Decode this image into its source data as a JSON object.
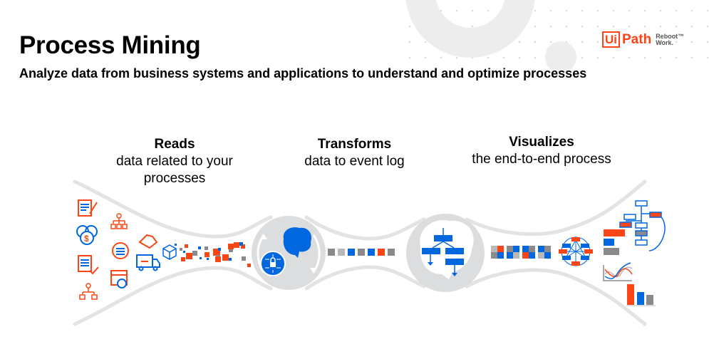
{
  "header": {
    "title": "Process Mining",
    "subtitle": "Analyze data from business systems and applications to understand and optimize processes"
  },
  "logo": {
    "brand_box": "Ui",
    "brand_text": "Path",
    "tagline_line1": "Reboot™",
    "tagline_line2": "Work."
  },
  "stages": [
    {
      "heading": "Reads",
      "line1": "data related to your",
      "line2": "processes"
    },
    {
      "heading": "Transforms",
      "line1": "data to event log",
      "line2": ""
    },
    {
      "heading": "Visualizes",
      "line1": "the end-to-end process",
      "line2": ""
    }
  ],
  "icons": {
    "sources": [
      "document-edit-icon",
      "currency-coins-icon",
      "document-check-icon",
      "org-chart-icon",
      "hierarchy-icon",
      "chat-bubble-icon",
      "calendar-clock-icon",
      "handshake-icon",
      "delivery-truck-icon",
      "cube-icon"
    ],
    "transform": [
      "brain-icon",
      "secure-circuit-icon",
      "refresh-arrows-icon"
    ],
    "visualize": [
      "flowchart-brain-icon",
      "network-graph-icon",
      "process-map-icon",
      "horizontal-bar-chart-icon",
      "line-chart-icon",
      "vertical-bar-chart-icon"
    ]
  },
  "colors": {
    "orange": "#fa4616",
    "blue": "#0067df",
    "gray": "#8a8a8c",
    "light_gray": "#b8b8b8",
    "pipe": "#e2e3e4"
  }
}
